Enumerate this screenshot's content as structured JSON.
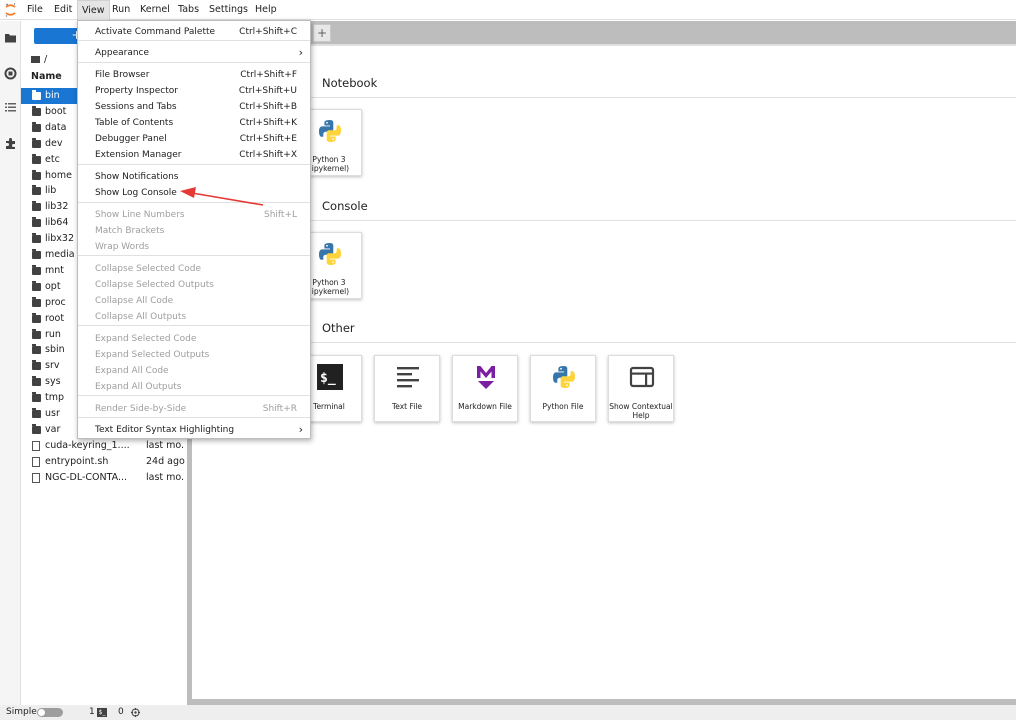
{
  "menubar": {
    "items": [
      "File",
      "Edit",
      "View",
      "Run",
      "Kernel",
      "Tabs",
      "Settings",
      "Help"
    ]
  },
  "file_browser": {
    "new_label": "+",
    "path": "/",
    "column_name": "Name",
    "rows": [
      {
        "name": "bin",
        "modified": "",
        "type": "folder",
        "selected": true
      },
      {
        "name": "boot",
        "modified": "",
        "type": "folder"
      },
      {
        "name": "data",
        "modified": "",
        "type": "folder"
      },
      {
        "name": "dev",
        "modified": "",
        "type": "folder"
      },
      {
        "name": "etc",
        "modified": "",
        "type": "folder"
      },
      {
        "name": "home",
        "modified": "",
        "type": "folder"
      },
      {
        "name": "lib",
        "modified": "",
        "type": "folder"
      },
      {
        "name": "lib32",
        "modified": "",
        "type": "folder"
      },
      {
        "name": "lib64",
        "modified": "",
        "type": "folder"
      },
      {
        "name": "libx32",
        "modified": "",
        "type": "folder"
      },
      {
        "name": "media",
        "modified": "",
        "type": "folder"
      },
      {
        "name": "mnt",
        "modified": "",
        "type": "folder"
      },
      {
        "name": "opt",
        "modified": "",
        "type": "folder"
      },
      {
        "name": "proc",
        "modified": "",
        "type": "folder"
      },
      {
        "name": "root",
        "modified": "",
        "type": "folder"
      },
      {
        "name": "run",
        "modified": "",
        "type": "folder"
      },
      {
        "name": "sbin",
        "modified": "",
        "type": "folder"
      },
      {
        "name": "srv",
        "modified": "",
        "type": "folder"
      },
      {
        "name": "sys",
        "modified": "",
        "type": "folder"
      },
      {
        "name": "tmp",
        "modified": "",
        "type": "folder"
      },
      {
        "name": "usr",
        "modified": "",
        "type": "folder"
      },
      {
        "name": "var",
        "modified": "",
        "type": "folder"
      },
      {
        "name": "cuda-keyring_1....",
        "modified": "last mo.",
        "type": "file"
      },
      {
        "name": "entrypoint.sh",
        "modified": "24d ago",
        "type": "file"
      },
      {
        "name": "NGC-DL-CONTA...",
        "modified": "last mo.",
        "type": "file"
      }
    ]
  },
  "tabs": {
    "add_label": "+"
  },
  "launcher": {
    "sections": [
      {
        "title": "Notebook",
        "cards": [
          {
            "label": "Python 3 (ipykernel)",
            "icon": "python-icon"
          }
        ]
      },
      {
        "title": "Console",
        "cards": [
          {
            "label": "Python 3 (ipykernel)",
            "icon": "python-icon"
          }
        ]
      },
      {
        "title": "Other",
        "cards": [
          {
            "label": "Terminal",
            "icon": "terminal-icon"
          },
          {
            "label": "Text File",
            "icon": "text-file-icon"
          },
          {
            "label": "Markdown File",
            "icon": "markdown-icon"
          },
          {
            "label": "Python File",
            "icon": "python-icon"
          },
          {
            "label": "Show Contextual Help",
            "icon": "contextual-help-icon"
          }
        ]
      }
    ]
  },
  "view_menu": {
    "items": [
      {
        "label": "Activate Command Palette",
        "shortcut": "Ctrl+Shift+C",
        "disabled": false
      },
      {
        "label": "Appearance",
        "shortcut": "",
        "submenu": true,
        "disabled": false
      },
      {
        "label": "File Browser",
        "shortcut": "Ctrl+Shift+F",
        "disabled": false
      },
      {
        "label": "Property Inspector",
        "shortcut": "Ctrl+Shift+U",
        "disabled": false
      },
      {
        "label": "Sessions and Tabs",
        "shortcut": "Ctrl+Shift+B",
        "disabled": false
      },
      {
        "label": "Table of Contents",
        "shortcut": "Ctrl+Shift+K",
        "disabled": false
      },
      {
        "label": "Debugger Panel",
        "shortcut": "Ctrl+Shift+E",
        "disabled": false
      },
      {
        "label": "Extension Manager",
        "shortcut": "Ctrl+Shift+X",
        "disabled": false
      },
      {
        "label": "Show Notifications",
        "shortcut": "",
        "disabled": false
      },
      {
        "label": "Show Log Console",
        "shortcut": "",
        "disabled": false
      },
      {
        "label": "Show Line Numbers",
        "shortcut": "Shift+L",
        "disabled": true
      },
      {
        "label": "Match Brackets",
        "shortcut": "",
        "disabled": true
      },
      {
        "label": "Wrap Words",
        "shortcut": "",
        "disabled": true
      },
      {
        "label": "Collapse Selected Code",
        "shortcut": "",
        "disabled": true
      },
      {
        "label": "Collapse Selected Outputs",
        "shortcut": "",
        "disabled": true
      },
      {
        "label": "Collapse All Code",
        "shortcut": "",
        "disabled": true
      },
      {
        "label": "Collapse All Outputs",
        "shortcut": "",
        "disabled": true
      },
      {
        "label": "Expand Selected Code",
        "shortcut": "",
        "disabled": true
      },
      {
        "label": "Expand Selected Outputs",
        "shortcut": "",
        "disabled": true
      },
      {
        "label": "Expand All Code",
        "shortcut": "",
        "disabled": true
      },
      {
        "label": "Expand All Outputs",
        "shortcut": "",
        "disabled": true
      },
      {
        "label": "Render Side-by-Side",
        "shortcut": "Shift+R",
        "disabled": true
      },
      {
        "label": "Text Editor Syntax Highlighting",
        "shortcut": "",
        "submenu": true,
        "disabled": false
      }
    ]
  },
  "statusbar": {
    "mode_label": "Simple",
    "terminals_count": "1",
    "kernels_count": "0"
  },
  "colors": {
    "accent": "#1976d2",
    "annotation_arrow": "#e53935"
  }
}
